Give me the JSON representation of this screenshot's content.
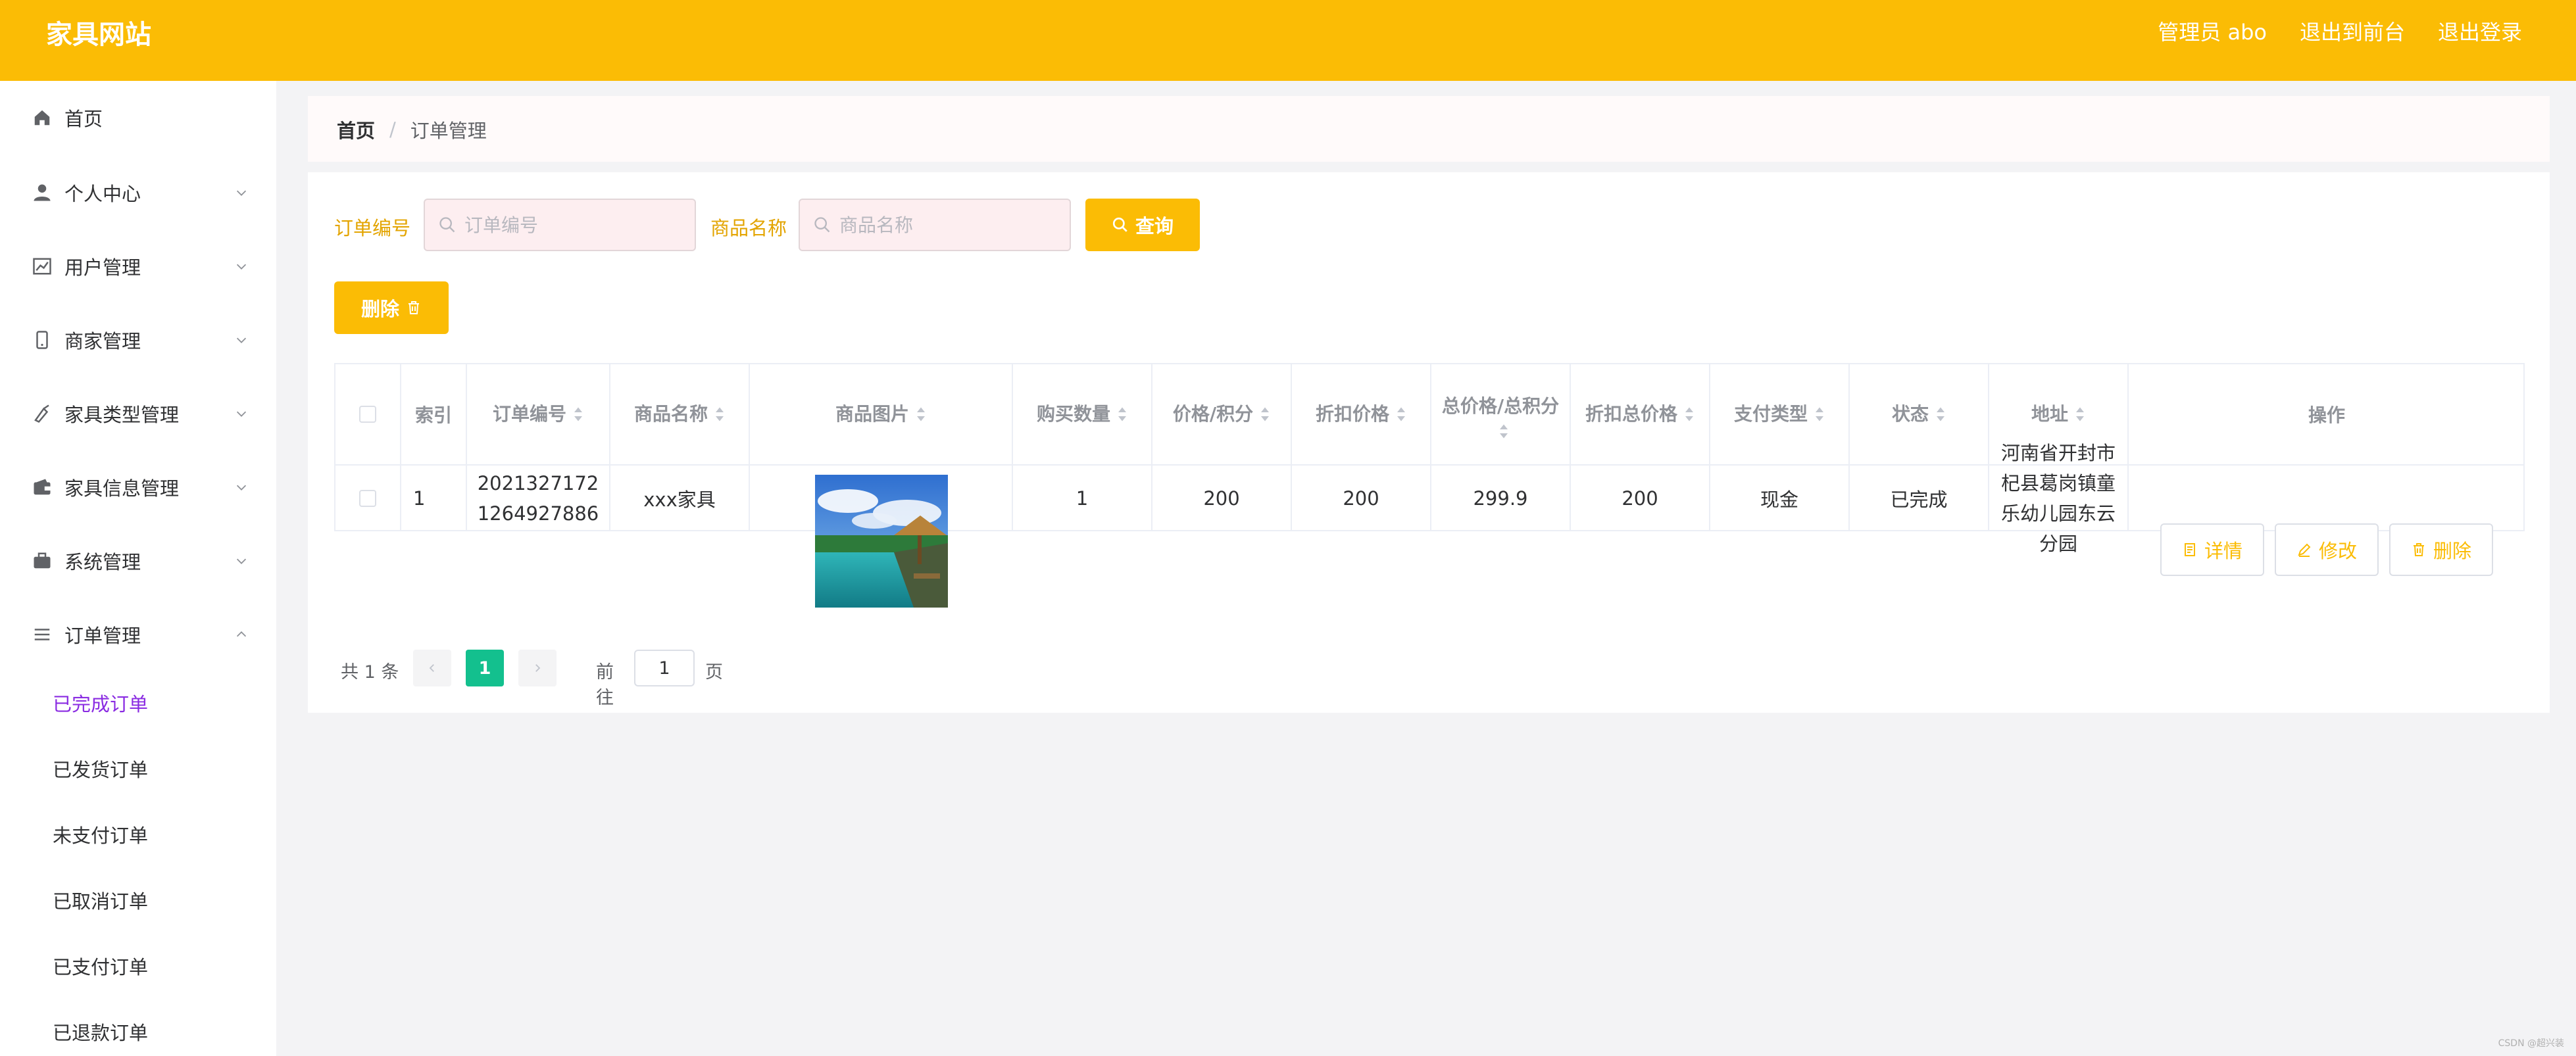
{
  "header": {
    "brand": "家具网站",
    "admin": "管理员 abo",
    "back_front": "退出到前台",
    "logout": "退出登录"
  },
  "sidebar": {
    "items": [
      {
        "label": "首页",
        "icon": "home-icon"
      },
      {
        "label": "个人中心",
        "icon": "user-icon"
      },
      {
        "label": "用户管理",
        "icon": "chart-icon"
      },
      {
        "label": "商家管理",
        "icon": "phone-icon"
      },
      {
        "label": "家具类型管理",
        "icon": "brush-icon"
      },
      {
        "label": "家具信息管理",
        "icon": "wallet-icon"
      },
      {
        "label": "系统管理",
        "icon": "briefcase-icon"
      },
      {
        "label": "订单管理",
        "icon": "list-icon"
      }
    ],
    "subitems": [
      "已完成订单",
      "已发货订单",
      "未支付订单",
      "已取消订单",
      "已支付订单",
      "已退款订单"
    ]
  },
  "breadcrumb": {
    "home": "首页",
    "separator": "/",
    "current": "订单管理"
  },
  "filters": {
    "order_no_label": "订单编号",
    "order_no_placeholder": "订单编号",
    "product_label": "商品名称",
    "product_placeholder": "商品名称",
    "query_button": "查询"
  },
  "toolbar": {
    "delete_button": "删除"
  },
  "table": {
    "headers": {
      "index": "索引",
      "order_no": "订单编号",
      "product_name": "商品名称",
      "product_image": "商品图片",
      "quantity": "购买数量",
      "price_points": "价格/积分",
      "discount_price": "折扣价格",
      "total_price": "总价格/总积分",
      "discount_total": "折扣总价格",
      "pay_type": "支付类型",
      "status": "状态",
      "address": "地址",
      "actions": "操作"
    },
    "rows": [
      {
        "index": "1",
        "order_no": "20213271721264927886",
        "product_name": "xxx家具",
        "quantity": "1",
        "price_points": "200",
        "discount_price": "200",
        "total_price": "299.9",
        "discount_total": "200",
        "pay_type": "现金",
        "status": "已完成",
        "address": "河南省开封市杞县葛岗镇童乐幼儿园东云分园",
        "detail_button": "详情",
        "edit_button": "修改",
        "delete_button": "删除"
      }
    ]
  },
  "pagination": {
    "total": "共 1 条",
    "current_page": "1",
    "goto_label": "前往",
    "goto_value": "1",
    "page_unit": "页"
  },
  "watermark": "CSDN @超兴装",
  "colors": {
    "primary": "#fbbc05",
    "active_page": "#13c08e",
    "active_menu": "#8a2be2"
  }
}
